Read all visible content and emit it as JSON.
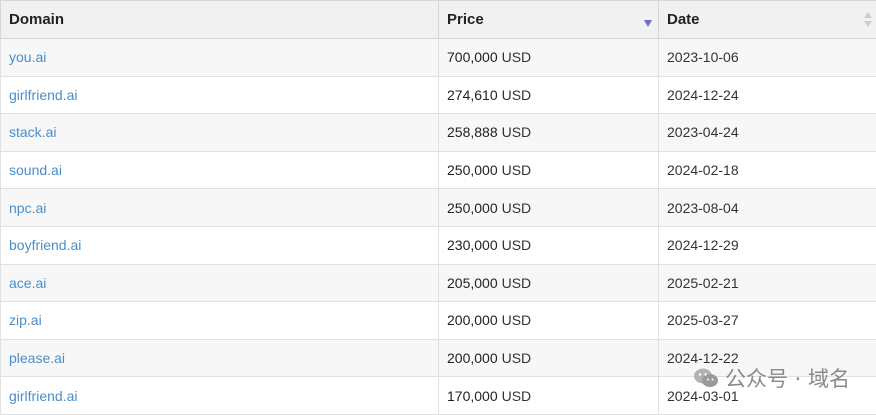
{
  "table": {
    "headers": {
      "domain": "Domain",
      "price": "Price",
      "date": "Date"
    },
    "sort": {
      "price": "descending",
      "date": "unsorted"
    },
    "rows": [
      {
        "domain": "you.ai",
        "price": "700,000",
        "currency": "USD",
        "date": "2023-10-06"
      },
      {
        "domain": "girlfriend.ai",
        "price": "274,610",
        "currency": "USD",
        "date": "2024-12-24"
      },
      {
        "domain": "stack.ai",
        "price": "258,888",
        "currency": "USD",
        "date": "2023-04-24"
      },
      {
        "domain": "sound.ai",
        "price": "250,000",
        "currency": "USD",
        "date": "2024-02-18"
      },
      {
        "domain": "npc.ai",
        "price": "250,000",
        "currency": "USD",
        "date": "2023-08-04"
      },
      {
        "domain": "boyfriend.ai",
        "price": "230,000",
        "currency": "USD",
        "date": "2024-12-29"
      },
      {
        "domain": "ace.ai",
        "price": "205,000",
        "currency": "USD",
        "date": "2025-02-21"
      },
      {
        "domain": "zip.ai",
        "price": "200,000",
        "currency": "USD",
        "date": "2025-03-27"
      },
      {
        "domain": "please.ai",
        "price": "200,000",
        "currency": "USD",
        "date": "2024-12-22"
      },
      {
        "domain": "girlfriend.ai",
        "price": "170,000",
        "currency": "USD",
        "date": "2024-03-01"
      }
    ]
  },
  "watermark": {
    "text": "公众号 · 域名",
    "icon": "wechat-icon"
  },
  "colors": {
    "link": "#4a8ec9",
    "header_bg": "#f1f1f1",
    "stripe_bg": "#f7f7f7",
    "sort_active": "#6b6ec8"
  }
}
